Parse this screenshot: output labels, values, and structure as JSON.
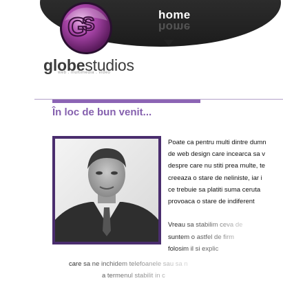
{
  "header": {
    "nav_home": "home",
    "brand_bold": "globe",
    "brand_light": "studios",
    "brand_tagline": "web . multimedia . video"
  },
  "main": {
    "section_title": "În loc de bun venit...",
    "intro_lines": [
      "Poate ca pentru multi dintre dumn",
      "de web design care incearca sa v",
      "despre care nu stiti prea multe, te",
      "creeaza o stare de neliniste, iar i",
      "ce trebuie sa platiti suma ceruta",
      "provoaca o stare de indiferent",
      "",
      "Vreau sa stabilim ceva de",
      "suntem o astfel de firm",
      "folosim il si explic"
    ],
    "intro_lines_wide": [
      "care sa ne inchidem telefoanele sau sa n",
      "a termenul stabilit in c"
    ]
  },
  "colors": {
    "accent_purple": "#8560ae",
    "portrait_frame": "#4a2d6e",
    "header_dark": "#232323"
  },
  "icons": {
    "logo": "globe-logo-icon"
  }
}
